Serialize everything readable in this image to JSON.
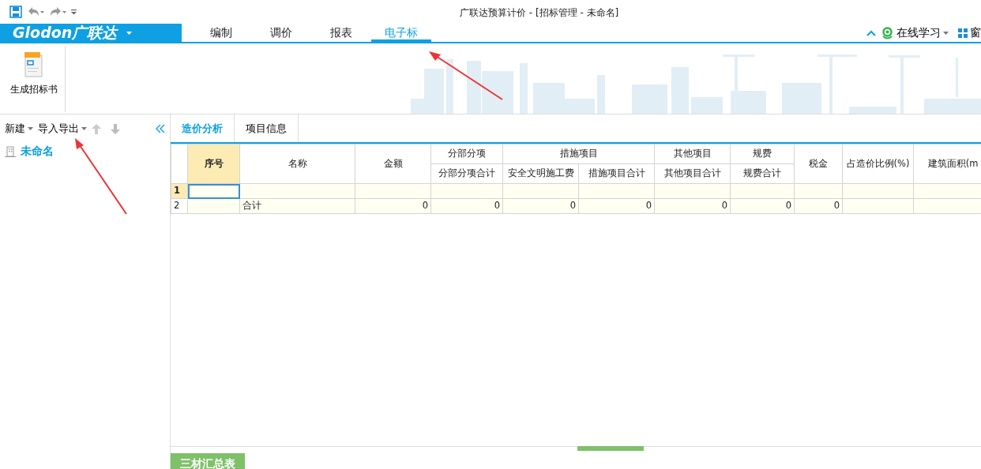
{
  "window": {
    "title": "广联达预算计价 - [招标管理 - 未命名]"
  },
  "logo": {
    "text": "Glodon广联达"
  },
  "menu_tabs": [
    {
      "label": "编制",
      "selected": false
    },
    {
      "label": "调价",
      "selected": false
    },
    {
      "label": "报表",
      "selected": false
    },
    {
      "label": "电子标",
      "selected": true
    }
  ],
  "right_tools": [
    {
      "kind": "help",
      "label": "在线学习"
    },
    {
      "kind": "window",
      "label": "窗"
    }
  ],
  "ribbon": {
    "buttons": [
      {
        "label": "生成招标书"
      }
    ]
  },
  "left_toolbar": {
    "items": [
      {
        "label": "新建"
      },
      {
        "label": "导入导出"
      }
    ]
  },
  "tree": [
    {
      "label": "未命名",
      "selected": true
    }
  ],
  "content_tabs": [
    {
      "label": "造价分析",
      "selected": true
    },
    {
      "label": "项目信息",
      "selected": false
    }
  ],
  "table": {
    "header_rows": [
      [
        {
          "label": "序号",
          "highlighted": true,
          "rowspan": 2
        },
        {
          "label": "名称",
          "rowspan": 2
        },
        {
          "label": "金额",
          "rowspan": 2
        },
        {
          "label": "分部分项"
        },
        {
          "label": "措施项目",
          "colspan": 2
        },
        {
          "label": "其他项目"
        },
        {
          "label": "规费"
        },
        {
          "label": "税金",
          "rowspan": 2
        },
        {
          "label": "占造价比例(%)",
          "rowspan": 2
        },
        {
          "label": "建筑面积(m",
          "rowspan": 2
        }
      ],
      [
        {
          "label": "分部分项合计"
        },
        {
          "label": "安全文明施工费"
        },
        {
          "label": "措施项目合计"
        },
        {
          "label": "其他项目合计"
        },
        {
          "label": "规费合计"
        }
      ]
    ],
    "rows": [
      {
        "number": "1",
        "selected": true,
        "cells": [
          null,
          null,
          null,
          null,
          null,
          null,
          null,
          null,
          null,
          null,
          null
        ]
      },
      {
        "number": "2",
        "selected": false,
        "cells": [
          null,
          "合计",
          "0",
          "0",
          "0",
          "0",
          "0",
          "0",
          "0",
          null,
          null
        ]
      }
    ]
  },
  "bottom_tabs": [
    {
      "label": "三材汇总表"
    }
  ]
}
